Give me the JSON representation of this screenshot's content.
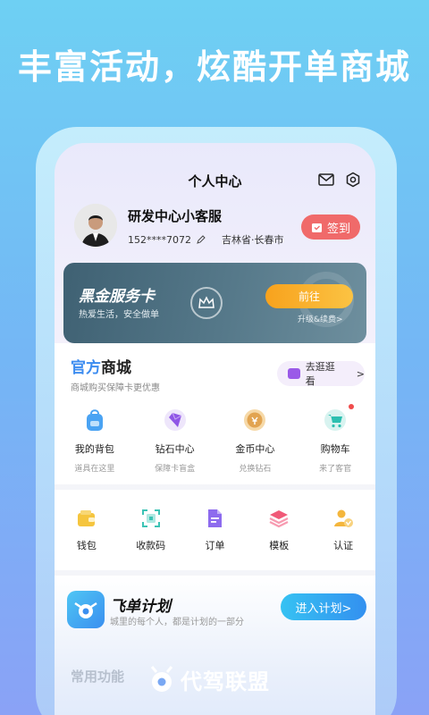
{
  "headline": "丰富活动，炫酷开单商城",
  "header": {
    "title": "个人中心"
  },
  "profile": {
    "name": "研发中心小客服",
    "phone": "152****7072",
    "location": "吉林省·长春市",
    "checkin_label": "签到"
  },
  "vip_card": {
    "title": "黑金服务卡",
    "subtitle": "热爱生活，安全做单",
    "button_label": "前往",
    "upgrade_label": "升级&续费>"
  },
  "shop": {
    "title_part1": "官方",
    "title_part2": "商城",
    "subtitle": "商城购买保障卡更优惠",
    "stroll_label": "去逛逛看",
    "stroll_arrow": ">",
    "items": [
      {
        "label": "我的背包",
        "desc": "道具在这里",
        "icon": "backpack-icon"
      },
      {
        "label": "钻石中心",
        "desc": "保障卡盲盒",
        "icon": "diamond-icon"
      },
      {
        "label": "金币中心",
        "desc": "兑换钻石",
        "icon": "coin-icon"
      },
      {
        "label": "购物车",
        "desc": "来了客官",
        "icon": "cart-icon"
      }
    ]
  },
  "tools": {
    "items": [
      {
        "label": "钱包",
        "icon": "wallet-icon"
      },
      {
        "label": "收款码",
        "icon": "qr-code-icon"
      },
      {
        "label": "订单",
        "icon": "order-icon"
      },
      {
        "label": "模板",
        "icon": "template-icon"
      },
      {
        "label": "认证",
        "icon": "verify-icon"
      }
    ]
  },
  "plan": {
    "title": "飞单计划",
    "subtitle": "城里的每个人，都是计划的一部分",
    "button_label": "进入计划>"
  },
  "common_functions_title": "常用功能",
  "brand": {
    "name": "代驾联盟"
  },
  "colors": {
    "accent_blue": "#3c8cf0",
    "checkin_red": "#f06a6a",
    "vip_orange": "#f8a21d"
  }
}
